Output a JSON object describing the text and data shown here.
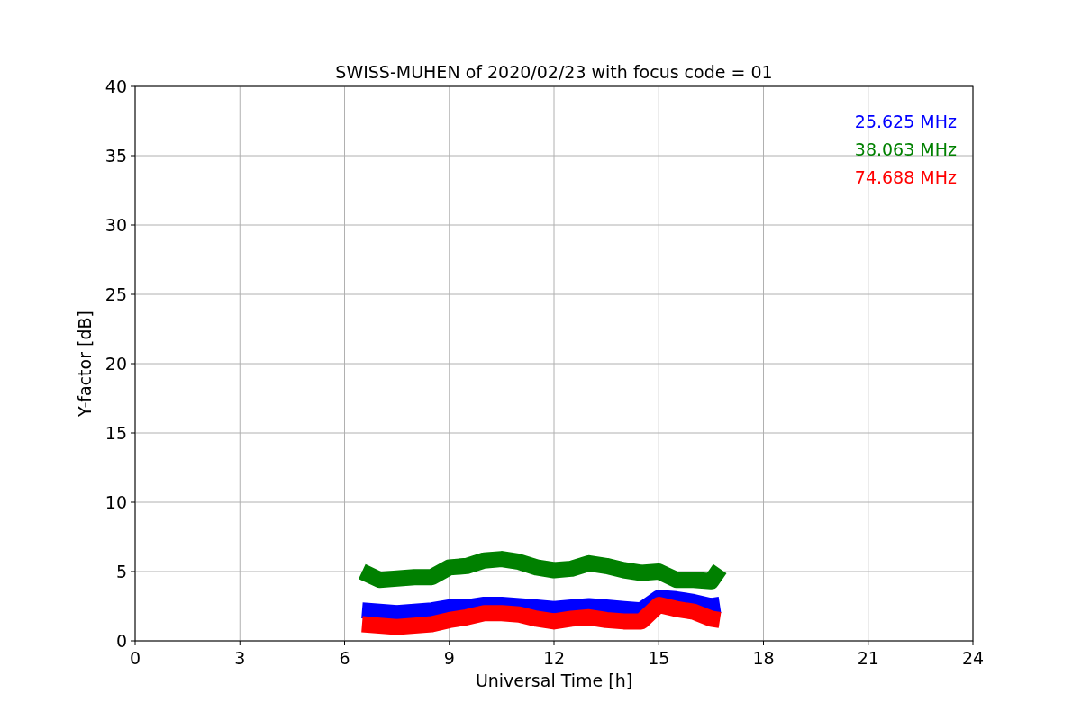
{
  "chart_data": {
    "type": "line",
    "title": "SWISS-MUHEN of 2020/02/23 with focus code = 01",
    "xlabel": "Universal Time [h]",
    "ylabel": "Y-factor [dB]",
    "x": [
      6.5,
      7,
      7.5,
      8,
      8.5,
      9,
      9.5,
      10,
      10.5,
      11,
      11.5,
      12,
      12.5,
      13,
      13.5,
      14,
      14.5,
      15,
      15.5,
      16,
      16.5,
      16.75
    ],
    "series": [
      {
        "name": "25.625 MHz",
        "color": "#0000ff",
        "values": [
          2.2,
          2.1,
          2.0,
          2.1,
          2.2,
          2.4,
          2.4,
          2.6,
          2.6,
          2.5,
          2.4,
          2.3,
          2.4,
          2.5,
          2.4,
          2.3,
          2.2,
          3.1,
          3.0,
          2.8,
          2.5,
          2.6
        ]
      },
      {
        "name": "38.063 MHz",
        "color": "#008000",
        "values": [
          5.0,
          4.4,
          4.5,
          4.6,
          4.6,
          5.3,
          5.4,
          5.8,
          5.9,
          5.7,
          5.3,
          5.1,
          5.2,
          5.6,
          5.4,
          5.1,
          4.9,
          5.0,
          4.4,
          4.4,
          4.3,
          5.2
        ]
      },
      {
        "name": "74.688 MHz",
        "color": "#ff0000",
        "values": [
          1.2,
          1.1,
          1.0,
          1.1,
          1.2,
          1.5,
          1.7,
          2.0,
          2.0,
          1.9,
          1.6,
          1.4,
          1.6,
          1.7,
          1.5,
          1.4,
          1.4,
          2.6,
          2.3,
          2.1,
          1.6,
          1.5
        ]
      }
    ],
    "grid": true,
    "xlim": [
      0,
      24
    ],
    "ylim": [
      0,
      40
    ],
    "xticks": [
      0,
      3,
      6,
      9,
      12,
      15,
      18,
      21,
      24
    ],
    "yticks": [
      0,
      5,
      10,
      15,
      20,
      25,
      30,
      35,
      40
    ]
  }
}
